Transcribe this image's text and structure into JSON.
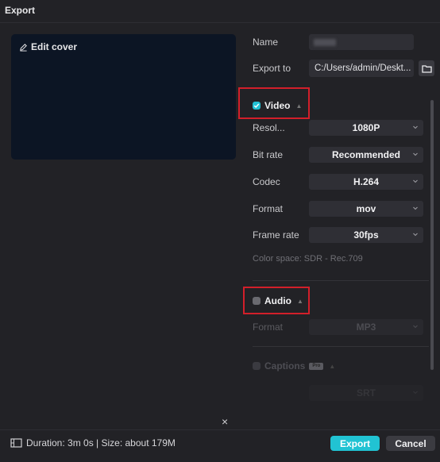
{
  "window": {
    "title": "Export"
  },
  "cover": {
    "edit_label": "Edit cover"
  },
  "file": {
    "name_label": "Name",
    "export_to_label": "Export to",
    "export_path": "C:/Users/admin/Deskt..."
  },
  "video": {
    "label": "Video",
    "checked": true,
    "resolution_label": "Resol...",
    "resolution": "1080P",
    "bitrate_label": "Bit rate",
    "bitrate": "Recommended",
    "codec_label": "Codec",
    "codec": "H.264",
    "format_label": "Format",
    "format": "mov",
    "framerate_label": "Frame rate",
    "framerate": "30fps",
    "color_space": "Color space: SDR - Rec.709"
  },
  "audio": {
    "label": "Audio",
    "checked": false,
    "format_label": "Format",
    "format": "MP3"
  },
  "captions": {
    "label": "Captions",
    "badge": "Pro",
    "format": "SRT"
  },
  "footer": {
    "close_symbol": "×",
    "info": "Duration: 3m 0s | Size: about 179M",
    "export_label": "Export",
    "cancel_label": "Cancel"
  },
  "colors": {
    "accent": "#21c3d3",
    "highlight_box": "#d21f2a",
    "background": "#222226"
  }
}
